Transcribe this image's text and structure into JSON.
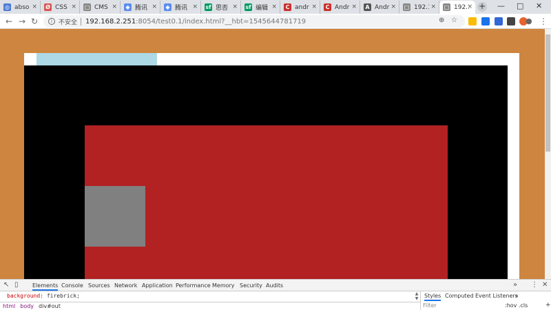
{
  "tabs": [
    {
      "title": "absol",
      "favicon": "globe-icon",
      "color": "#4a7bd6",
      "glyph": "◎"
    },
    {
      "title": "CSS",
      "favicon": "csdn-icon",
      "color": "#d9534f",
      "glyph": "Ø"
    },
    {
      "title": "CMS",
      "favicon": "page-icon",
      "color": "#888888",
      "glyph": "□"
    },
    {
      "title": "腾讯",
      "favicon": "tencent-icon",
      "color": "#5b8def",
      "glyph": "◆"
    },
    {
      "title": "腾讯",
      "favicon": "tencent-icon",
      "color": "#5b8def",
      "glyph": "◆"
    },
    {
      "title": "思否",
      "favicon": "segmentfault-icon",
      "color": "#009a61",
      "glyph": "sf"
    },
    {
      "title": "编辑",
      "favicon": "segmentfault-icon",
      "color": "#009a61",
      "glyph": "sf"
    },
    {
      "title": "andr",
      "favicon": "csdn-icon",
      "color": "#c9302c",
      "glyph": "C"
    },
    {
      "title": "Andr",
      "favicon": "csdn-icon",
      "color": "#c9302c",
      "glyph": "C"
    },
    {
      "title": "Andr",
      "favicon": "github-icon",
      "color": "#555555",
      "glyph": "A"
    },
    {
      "title": "192.1",
      "favicon": "page-icon",
      "color": "#888888",
      "glyph": "□"
    },
    {
      "title": "192.1",
      "favicon": "page-icon",
      "color": "#888888",
      "glyph": "□",
      "active": true
    }
  ],
  "tab_close": "×",
  "new_tab": "+",
  "window": {
    "minimize": "—",
    "maximize": "□",
    "close": "✕"
  },
  "toolbar": {
    "back": "←",
    "forward": "→",
    "reload": "↻",
    "info": "i",
    "insecure_label": "不安全",
    "url_host": "192.168.2.251",
    "url_rest": ":8054/test0.1/index.html?__hbt=1545644781719",
    "zoom": "⊕",
    "star": "☆",
    "account": "●",
    "menu": "⋮"
  },
  "extensions": [
    {
      "name": "ext-google-icon",
      "color": "#fbbc05"
    },
    {
      "name": "ext-shield-icon",
      "color": "#1a73e8"
    },
    {
      "name": "ext-blue-icon",
      "color": "#3367d6"
    },
    {
      "name": "ext-dark-icon",
      "color": "#444444"
    },
    {
      "name": "ext-orange-icon",
      "color": "#e8622c"
    }
  ],
  "colors": {
    "page_bg": "#cd853f",
    "outer_box": "#ffffff",
    "lightblue_box": "#add8e6",
    "out_box": "#000000",
    "inner_box": "#b22222",
    "grey_box": "#808080"
  },
  "devtools": {
    "tabs": [
      "Elements",
      "Console",
      "Sources",
      "Network",
      "Application",
      "Performance",
      "Memory",
      "Security",
      "Audits"
    ],
    "more": "»",
    "menu": "⋮",
    "close": "✕",
    "inspect_icon": "↖",
    "device_icon": "▯",
    "code_prop": "background",
    "code_value": "firebrick;",
    "crumbs": [
      "html",
      "body",
      "div#out"
    ],
    "right_tabs": [
      "Styles",
      "Computed",
      "Event Listeners"
    ],
    "right_more": "»",
    "filter_placeholder": "Filter",
    "hov_cls": ":hov .cls",
    "plus": "+"
  }
}
